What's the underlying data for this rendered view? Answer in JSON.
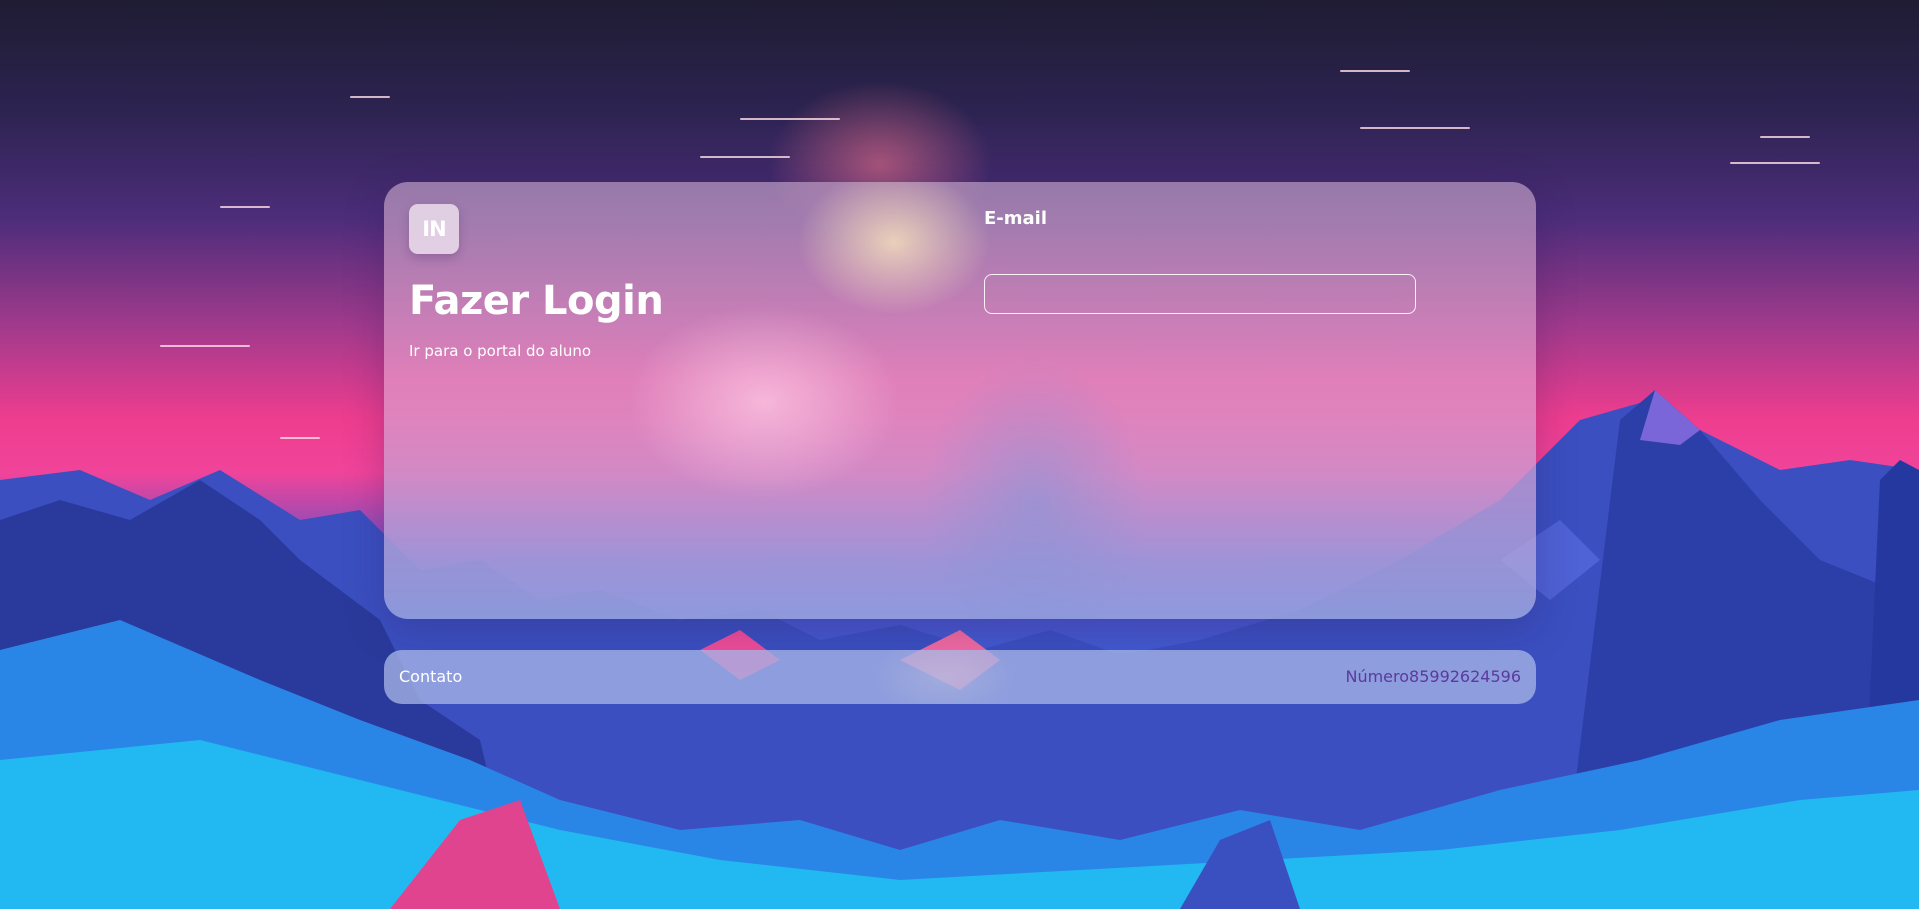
{
  "logo": {
    "text": "IN"
  },
  "login": {
    "title": "Fazer Login",
    "subtitle": "Ir para o portal do aluno",
    "email_label": "E-mail",
    "email_value": "",
    "email_placeholder": ""
  },
  "footer": {
    "contact_label": "Contato",
    "phone_text": "Número85992624596"
  },
  "colors": {
    "accent_text": "#5b3a9e",
    "bg_top": "#1f1c33",
    "bg_mid_pink": "#ee3d8f",
    "bg_bottom_cyan": "#1ec0f0"
  }
}
